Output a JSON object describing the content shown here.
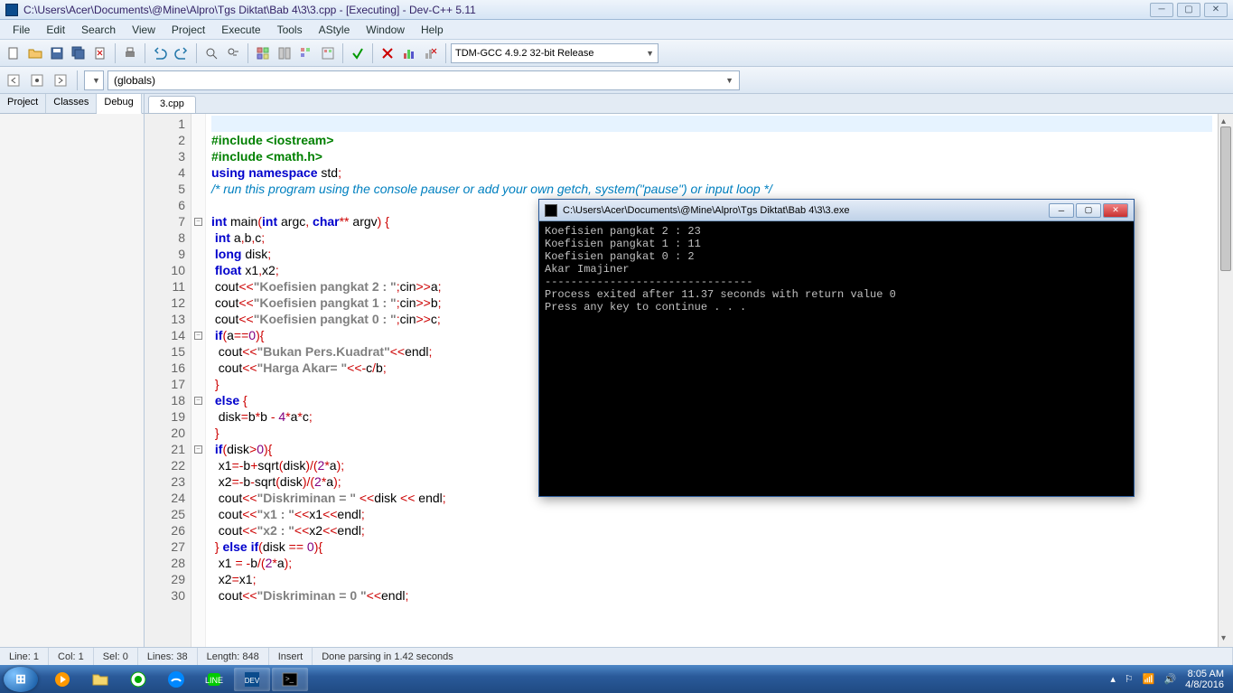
{
  "titlebar": {
    "text": "C:\\Users\\Acer\\Documents\\@Mine\\Alpro\\Tgs Diktat\\Bab 4\\3\\3.cpp - [Executing] - Dev-C++ 5.11"
  },
  "menus": [
    "File",
    "Edit",
    "Search",
    "View",
    "Project",
    "Execute",
    "Tools",
    "AStyle",
    "Window",
    "Help"
  ],
  "compiler_combo": "TDM-GCC 4.9.2 32-bit Release",
  "globals_combo": "(globals)",
  "left_tabs": [
    "Project",
    "Classes",
    "Debug"
  ],
  "left_active": "Debug",
  "file_tab": "3.cpp",
  "code": {
    "lines": [
      {
        "n": 1,
        "cls": "current-line",
        "html": "&nbsp;"
      },
      {
        "n": 2,
        "html": "<span class='k-green'>#include &lt;iostream&gt;</span>"
      },
      {
        "n": 3,
        "html": "<span class='k-green'>#include &lt;math.h&gt;</span>"
      },
      {
        "n": 4,
        "html": "<span class='k-blue'>using</span> <span class='k-blue'>namespace</span> std<span class='k-red'>;</span>"
      },
      {
        "n": 5,
        "html": "<span class='k-cmt'>/* run this program using the console pauser or add your own getch, system(\"pause\") or input loop */</span>"
      },
      {
        "n": 6,
        "html": "&nbsp;"
      },
      {
        "n": 7,
        "fold": true,
        "html": "<span class='k-blue'>int</span> main<span class='k-red'>(</span><span class='k-blue'>int</span> argc<span class='k-red'>,</span> <span class='k-blue'>char</span><span class='k-red'>**</span> argv<span class='k-red'>)</span> <span class='k-red'>{</span>"
      },
      {
        "n": 8,
        "html": " <span class='k-blue'>int</span> a<span class='k-red'>,</span>b<span class='k-red'>,</span>c<span class='k-red'>;</span>"
      },
      {
        "n": 9,
        "html": " <span class='k-blue'>long</span> disk<span class='k-red'>;</span>"
      },
      {
        "n": 10,
        "html": " <span class='k-blue'>float</span> x1<span class='k-red'>,</span>x2<span class='k-red'>;</span>"
      },
      {
        "n": 11,
        "html": " cout<span class='k-red'>&lt;&lt;</span><span class='k-str'>\"Koefisien pangkat 2 : \"</span><span class='k-red'>;</span>cin<span class='k-red'>&gt;&gt;</span>a<span class='k-red'>;</span>"
      },
      {
        "n": 12,
        "html": " cout<span class='k-red'>&lt;&lt;</span><span class='k-str'>\"Koefisien pangkat 1 : \"</span><span class='k-red'>;</span>cin<span class='k-red'>&gt;&gt;</span>b<span class='k-red'>;</span>"
      },
      {
        "n": 13,
        "html": " cout<span class='k-red'>&lt;&lt;</span><span class='k-str'>\"Koefisien pangkat 0 : \"</span><span class='k-red'>;</span>cin<span class='k-red'>&gt;&gt;</span>c<span class='k-red'>;</span>"
      },
      {
        "n": 14,
        "fold": true,
        "html": " <span class='k-blue'>if</span><span class='k-red'>(</span>a<span class='k-red'>==</span><span class='k-num'>0</span><span class='k-red'>){</span>"
      },
      {
        "n": 15,
        "html": "  cout<span class='k-red'>&lt;&lt;</span><span class='k-str'>\"Bukan Pers.Kuadrat\"</span><span class='k-red'>&lt;&lt;</span>endl<span class='k-red'>;</span>"
      },
      {
        "n": 16,
        "html": "  cout<span class='k-red'>&lt;&lt;</span><span class='k-str'>\"Harga Akar= \"</span><span class='k-red'>&lt;&lt;-</span>c<span class='k-red'>/</span>b<span class='k-red'>;</span>"
      },
      {
        "n": 17,
        "html": " <span class='k-red'>}</span>"
      },
      {
        "n": 18,
        "fold": true,
        "html": " <span class='k-blue'>else</span> <span class='k-red'>{</span>"
      },
      {
        "n": 19,
        "html": "  disk<span class='k-red'>=</span>b<span class='k-red'>*</span>b <span class='k-red'>-</span> <span class='k-num'>4</span><span class='k-red'>*</span>a<span class='k-red'>*</span>c<span class='k-red'>;</span>"
      },
      {
        "n": 20,
        "html": " <span class='k-red'>}</span>"
      },
      {
        "n": 21,
        "fold": true,
        "html": " <span class='k-blue'>if</span><span class='k-red'>(</span>disk<span class='k-red'>&gt;</span><span class='k-num'>0</span><span class='k-red'>){</span>"
      },
      {
        "n": 22,
        "html": "  x1<span class='k-red'>=-</span>b<span class='k-red'>+</span>sqrt<span class='k-red'>(</span>disk<span class='k-red'>)/(</span><span class='k-num'>2</span><span class='k-red'>*</span>a<span class='k-red'>);</span>"
      },
      {
        "n": 23,
        "html": "  x2<span class='k-red'>=-</span>b<span class='k-red'>-</span>sqrt<span class='k-red'>(</span>disk<span class='k-red'>)/(</span><span class='k-num'>2</span><span class='k-red'>*</span>a<span class='k-red'>);</span>"
      },
      {
        "n": 24,
        "html": "  cout<span class='k-red'>&lt;&lt;</span><span class='k-str'>\"Diskriminan = \"</span> <span class='k-red'>&lt;&lt;</span>disk <span class='k-red'>&lt;&lt;</span> endl<span class='k-red'>;</span>"
      },
      {
        "n": 25,
        "html": "  cout<span class='k-red'>&lt;&lt;</span><span class='k-str'>\"x1 : \"</span><span class='k-red'>&lt;&lt;</span>x1<span class='k-red'>&lt;&lt;</span>endl<span class='k-red'>;</span>"
      },
      {
        "n": 26,
        "html": "  cout<span class='k-red'>&lt;&lt;</span><span class='k-str'>\"x2 : \"</span><span class='k-red'>&lt;&lt;</span>x2<span class='k-red'>&lt;&lt;</span>endl<span class='k-red'>;</span>"
      },
      {
        "n": 27,
        "html": " <span class='k-red'>}</span> <span class='k-blue'>else</span> <span class='k-blue'>if</span><span class='k-red'>(</span>disk <span class='k-red'>==</span> <span class='k-num'>0</span><span class='k-red'>){</span>"
      },
      {
        "n": 28,
        "html": "  x1 <span class='k-red'>= -</span>b<span class='k-red'>/(</span><span class='k-num'>2</span><span class='k-red'>*</span>a<span class='k-red'>);</span>"
      },
      {
        "n": 29,
        "html": "  x2<span class='k-red'>=</span>x1<span class='k-red'>;</span>"
      },
      {
        "n": 30,
        "html": "  cout<span class='k-red'>&lt;&lt;</span><span class='k-str'>\"Diskriminan = 0 \"</span><span class='k-red'>&lt;&lt;</span>endl<span class='k-red'>;</span>"
      }
    ]
  },
  "status": {
    "line": "Line:  1",
    "col": "Col:  1",
    "sel": "Sel:  0",
    "lines": "Lines:  38",
    "length": "Length:  848",
    "insert": "Insert",
    "parse": "Done parsing in 1.42 seconds"
  },
  "console": {
    "title": "C:\\Users\\Acer\\Documents\\@Mine\\Alpro\\Tgs Diktat\\Bab 4\\3\\3.exe",
    "lines": [
      "Koefisien pangkat 2 : 23",
      "Koefisien pangkat 1 : 11",
      "Koefisien pangkat 0 : 2",
      "Akar Imajiner",
      "--------------------------------",
      "Process exited after 11.37 seconds with return value 0",
      "Press any key to continue . . ."
    ]
  },
  "tray": {
    "time": "8:05 AM",
    "date": "4/8/2016"
  }
}
